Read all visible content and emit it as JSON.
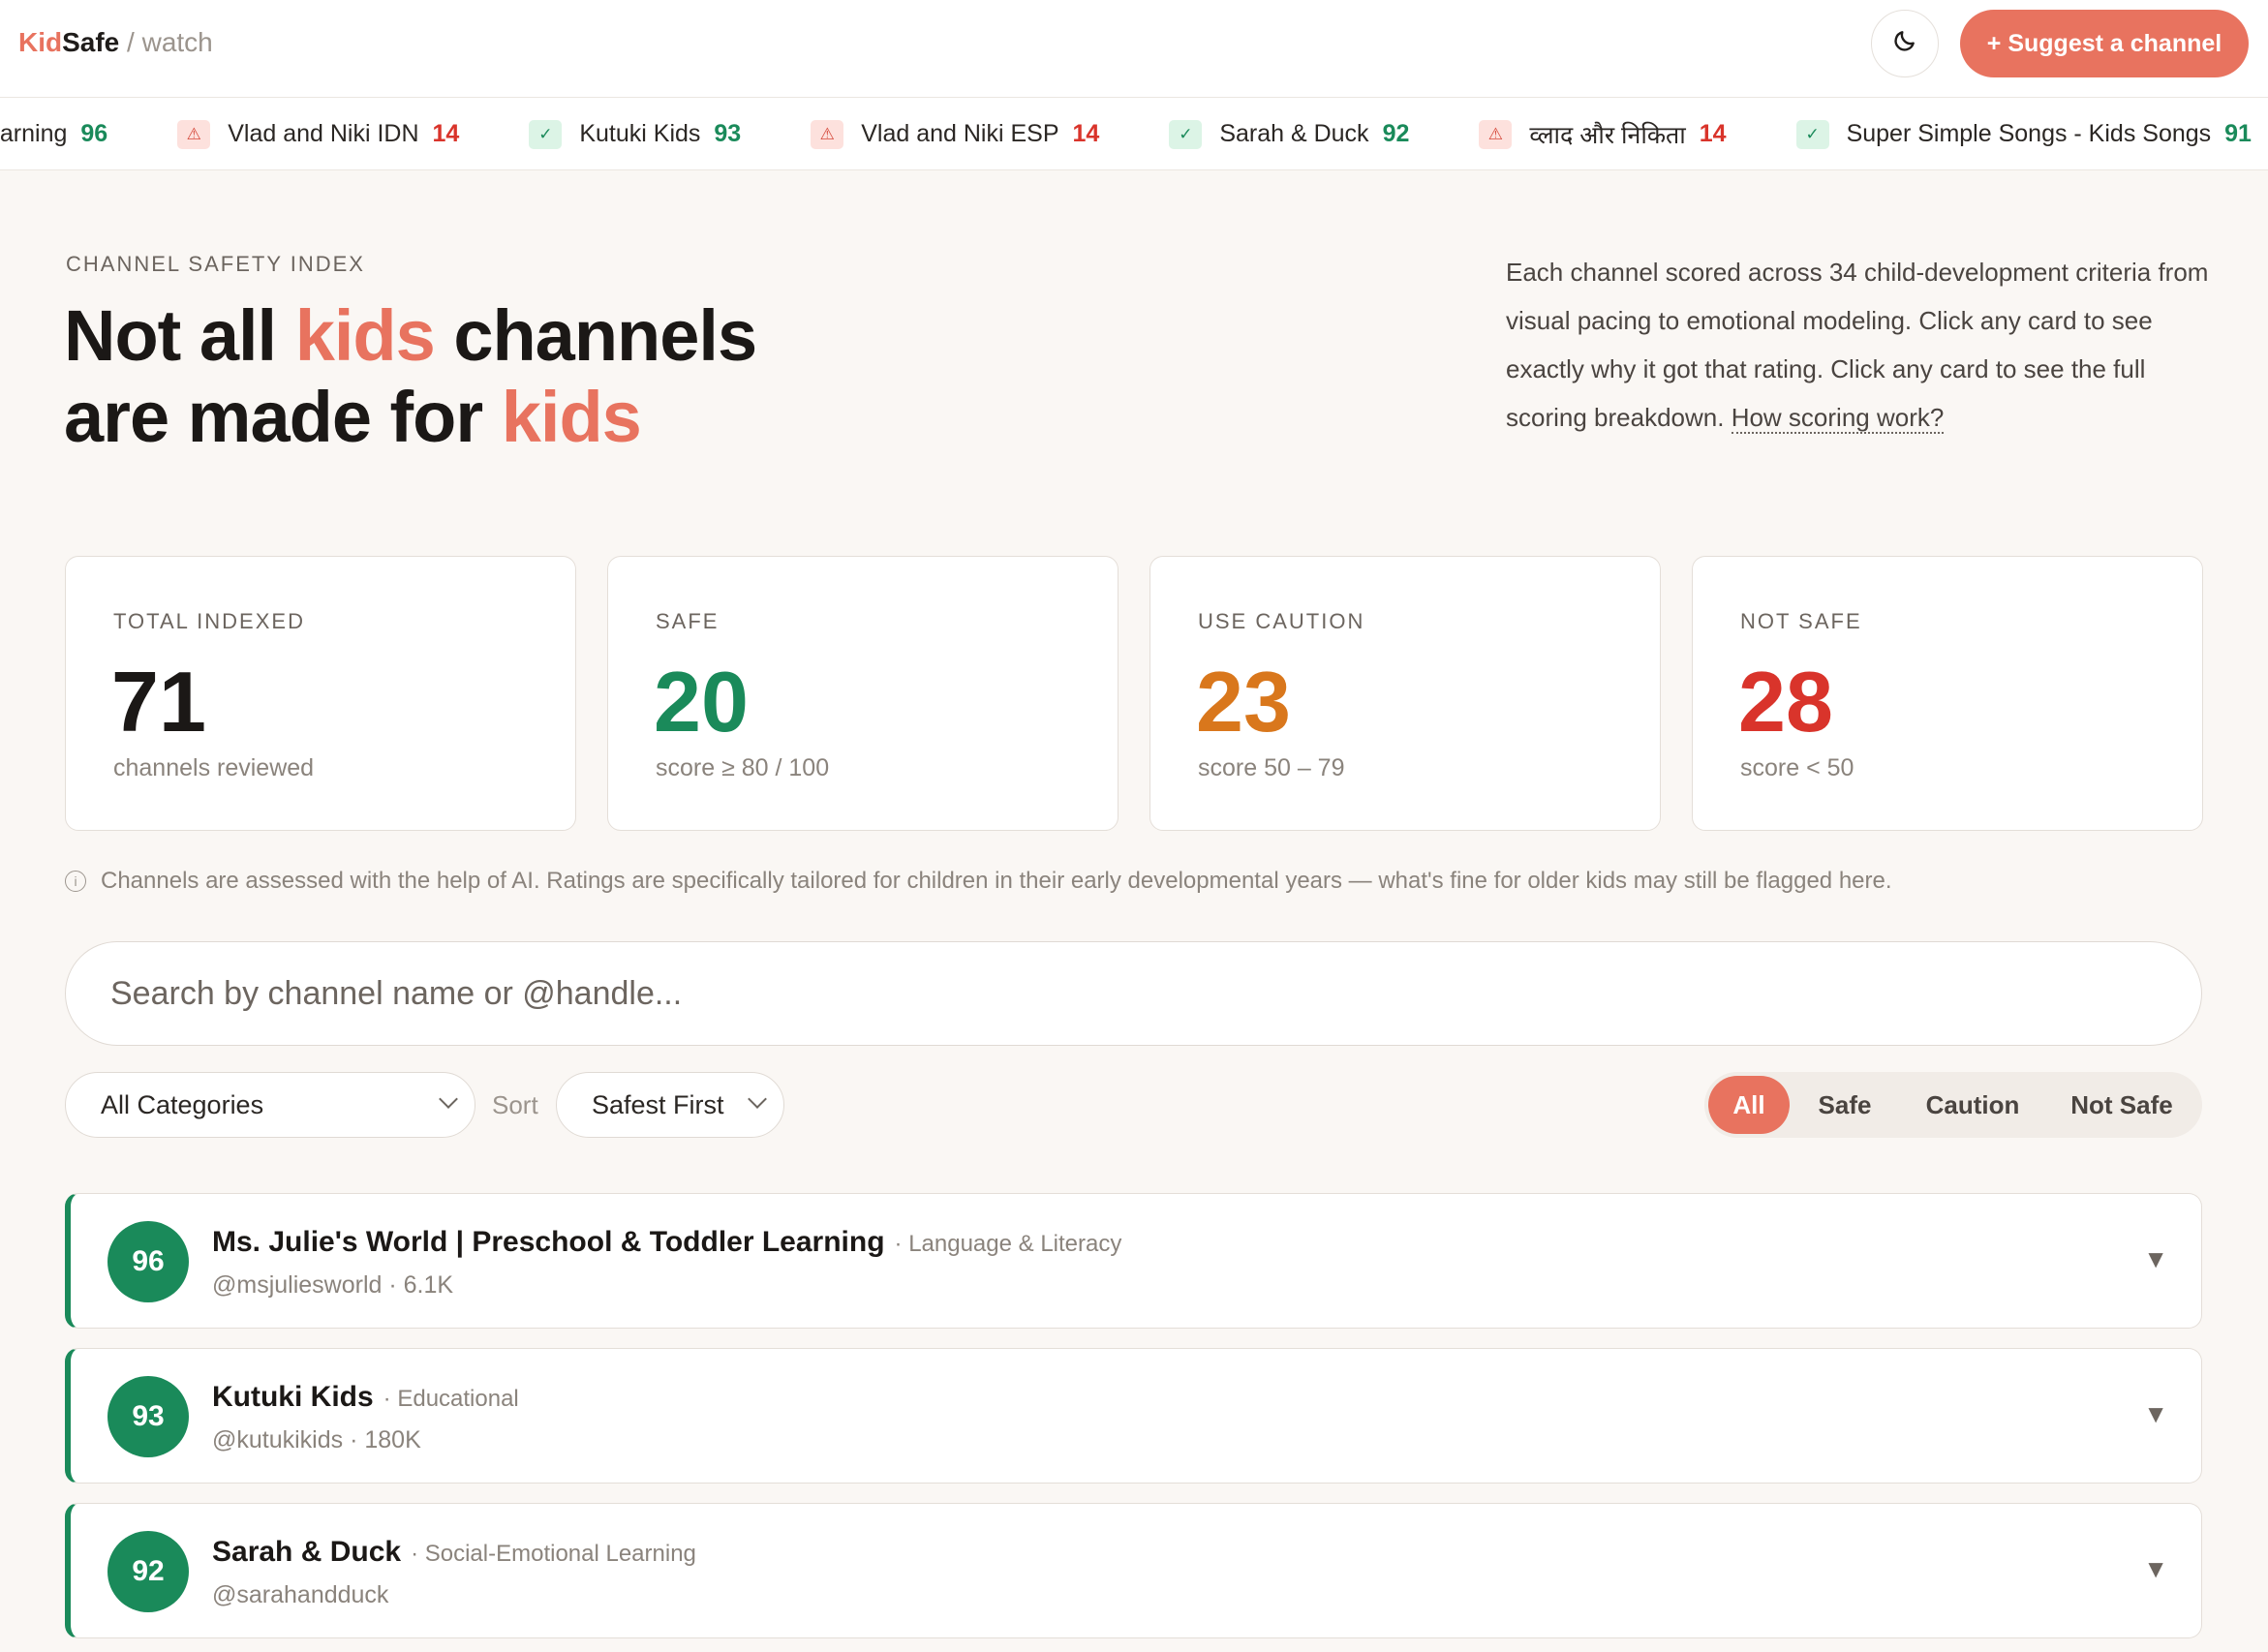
{
  "header": {
    "logo_kid": "Kid",
    "logo_safe": "Safe",
    "logo_suffix": " / watch",
    "theme_icon": "moon-icon",
    "suggest_label": "+ Suggest a channel"
  },
  "ticker": [
    {
      "name": "earning",
      "score": "96",
      "status": "safe"
    },
    {
      "name": "Vlad and Niki IDN",
      "score": "14",
      "status": "bad"
    },
    {
      "name": "Kutuki Kids",
      "score": "93",
      "status": "safe"
    },
    {
      "name": "Vlad and Niki ESP",
      "score": "14",
      "status": "bad"
    },
    {
      "name": "Sarah & Duck",
      "score": "92",
      "status": "safe"
    },
    {
      "name": "व्लाद और निकिता",
      "score": "14",
      "status": "bad"
    },
    {
      "name": "Super Simple Songs - Kids Songs",
      "score": "91",
      "status": "safe"
    }
  ],
  "hero": {
    "eyebrow": "CHANNEL SAFETY INDEX",
    "title_part1": "Not all ",
    "title_accent1": "kids",
    "title_part2": " channels",
    "title_part3": "are made for ",
    "title_accent2": "kids",
    "intro_text": "Each channel scored across 34 child-development criteria from visual pacing to emotional modeling. Click any card to see exactly why it got that rating. Click any card to see the full scoring breakdown. ",
    "intro_link": "How scoring work?"
  },
  "stats": {
    "total": {
      "label": "TOTAL INDEXED",
      "value": "71",
      "sub": "channels reviewed"
    },
    "safe": {
      "label": "SAFE",
      "value": "20",
      "sub": "score ≥ 80 / 100"
    },
    "caution": {
      "label": "USE CAUTION",
      "value": "23",
      "sub": "score 50 – 79"
    },
    "bad": {
      "label": "NOT SAFE",
      "value": "28",
      "sub": "score < 50"
    }
  },
  "notice": "Channels are assessed with the help of AI. Ratings are specifically tailored for children in their early developmental years — what's fine for older kids may still be flagged here.",
  "search": {
    "placeholder": "Search by channel name or @handle..."
  },
  "filters": {
    "category": "All Categories",
    "sort_label": "Sort",
    "sort": "Safest First",
    "segments": [
      "All",
      "Safe",
      "Caution",
      "Not Safe"
    ],
    "active_segment": "All"
  },
  "channels": [
    {
      "score": "96",
      "name": "Ms. Julie's World | Preschool & Toddler Learning",
      "category": "· Language & Literacy",
      "meta": "@msjuliesworld · 6.1K"
    },
    {
      "score": "93",
      "name": "Kutuki Kids",
      "category": "· Educational",
      "meta": "@kutukikids · 180K"
    },
    {
      "score": "92",
      "name": "Sarah & Duck",
      "category": "· Social-Emotional Learning",
      "meta": "@sarahandduck"
    }
  ],
  "colors": {
    "accent": "#e8735f",
    "safe": "#1a8a5a",
    "caution": "#d9771c",
    "bad": "#d9342b"
  }
}
